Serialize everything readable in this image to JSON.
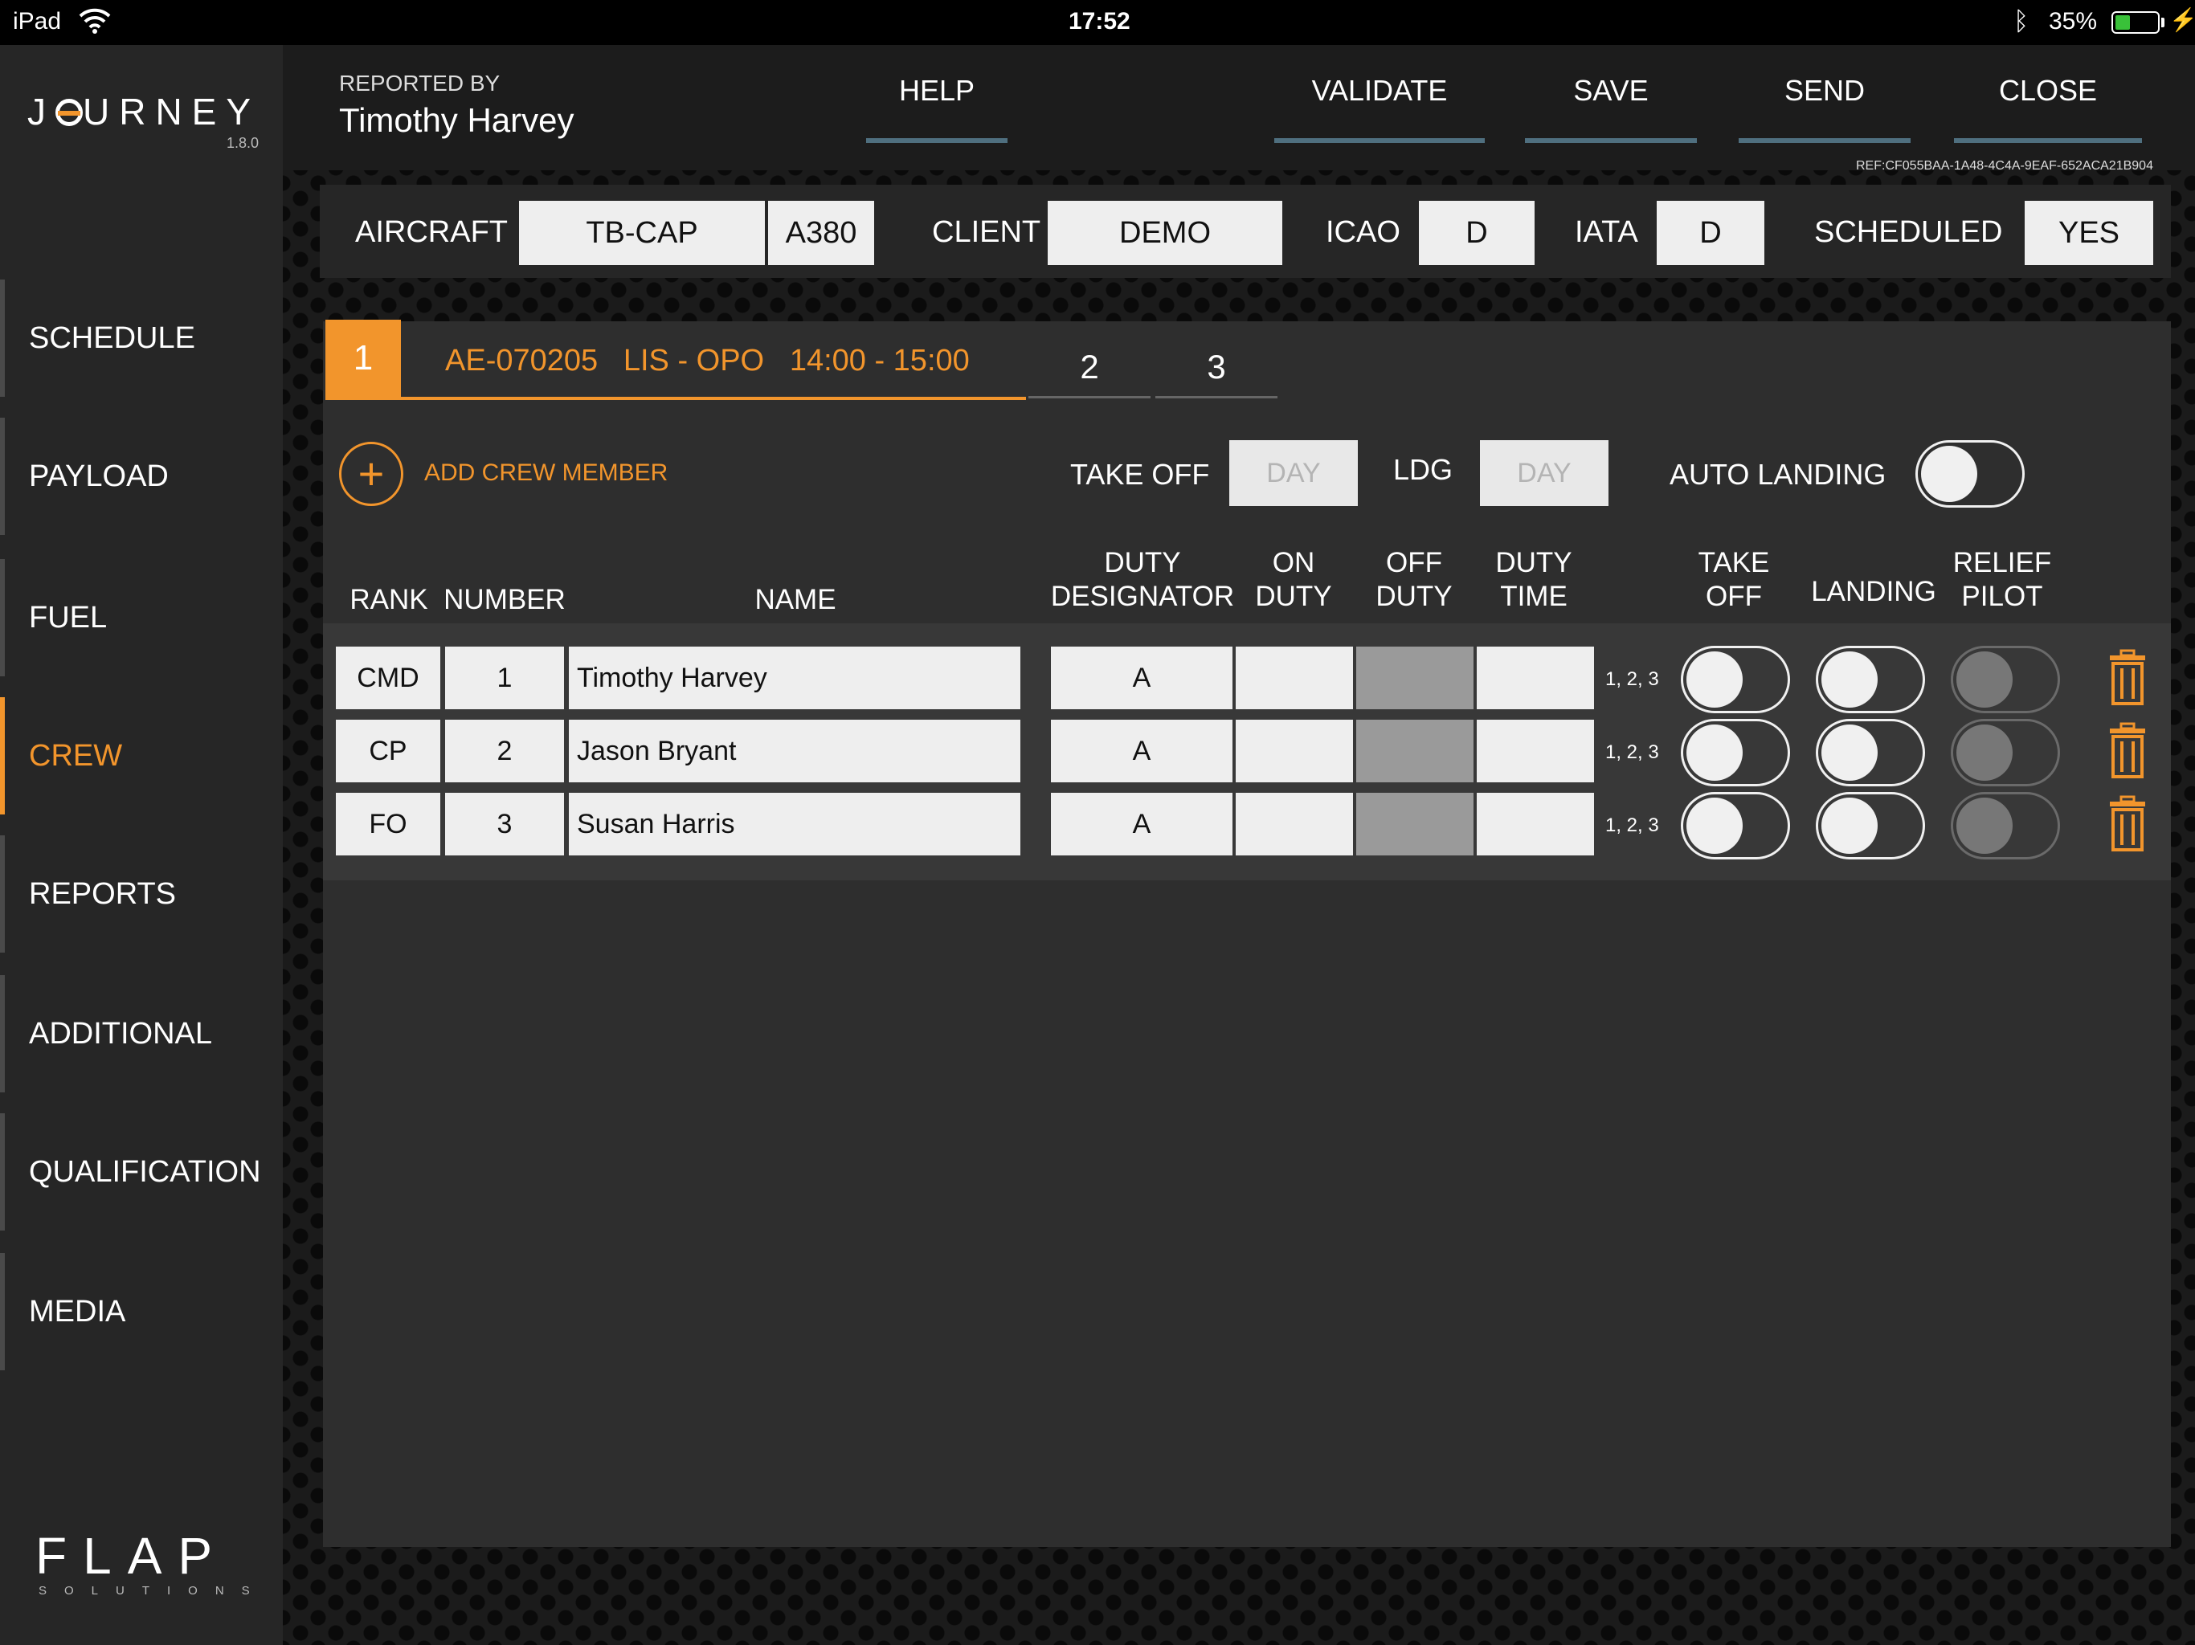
{
  "status_bar": {
    "device": "iPad",
    "time": "17:52",
    "battery": "35%",
    "battery_level": 0.35
  },
  "app": {
    "logo": "JOURNEY",
    "version": "1.8.0",
    "vendor_logo": "FLAP",
    "vendor_sub": "SOLUTIONS"
  },
  "sidebar": {
    "items": [
      {
        "label": "SCHEDULE",
        "active": false
      },
      {
        "label": "PAYLOAD",
        "active": false
      },
      {
        "label": "FUEL",
        "active": false
      },
      {
        "label": "CREW",
        "active": true
      },
      {
        "label": "REPORTS",
        "active": false
      },
      {
        "label": "ADDITIONAL",
        "active": false
      },
      {
        "label": "QUALIFICATION",
        "active": false
      },
      {
        "label": "MEDIA",
        "active": false
      }
    ]
  },
  "header": {
    "reported_by_label": "REPORTED BY",
    "reported_by_name": "Timothy Harvey",
    "buttons": {
      "help": "HELP",
      "validate": "VALIDATE",
      "save": "SAVE",
      "send": "SEND",
      "close": "CLOSE"
    },
    "ref": "REF:CF055BAA-1A48-4C4A-9EAF-652ACA21B904"
  },
  "aircraft_bar": {
    "aircraft_label": "AIRCRAFT",
    "aircraft_reg": "TB-CAP",
    "aircraft_type": "A380",
    "client_label": "CLIENT",
    "client": "DEMO",
    "icao_label": "ICAO",
    "icao": "D",
    "iata_label": "IATA",
    "iata": "D",
    "scheduled_label": "SCHEDULED",
    "scheduled": "YES"
  },
  "flight_tabs": {
    "active_number": "1",
    "active_flight": "AE-070205",
    "active_route": "LIS - OPO",
    "active_time": "14:00 - 15:00",
    "others": [
      "2",
      "3"
    ]
  },
  "crew_options": {
    "add_label": "ADD CREW MEMBER",
    "take_off_label": "TAKE OFF",
    "take_off_value": "DAY",
    "ldg_label": "LDG",
    "ldg_value": "DAY",
    "auto_landing_label": "AUTO LANDING",
    "auto_landing": false
  },
  "table": {
    "headers": {
      "rank": "RANK",
      "number": "NUMBER",
      "name": "NAME",
      "duty_designator_1": "DUTY",
      "duty_designator_2": "DESIGNATOR",
      "on_duty_1": "ON",
      "on_duty_2": "DUTY",
      "off_duty_1": "OFF",
      "off_duty_2": "DUTY",
      "duty_time_1": "DUTY",
      "duty_time_2": "TIME",
      "take_off_1": "TAKE",
      "take_off_2": "OFF",
      "landing": "LANDING",
      "relief_1": "RELIEF",
      "relief_2": "PILOT"
    },
    "rows": [
      {
        "rank": "CMD",
        "number": "1",
        "name": "Timothy Harvey",
        "designator": "A",
        "on_duty": "",
        "off_duty": "",
        "duty_time": "",
        "legs": "1, 2, 3"
      },
      {
        "rank": "CP",
        "number": "2",
        "name": "Jason Bryant",
        "designator": "A",
        "on_duty": "",
        "off_duty": "",
        "duty_time": "",
        "legs": "1, 2, 3"
      },
      {
        "rank": "FO",
        "number": "3",
        "name": "Susan Harris",
        "designator": "A",
        "on_duty": "",
        "off_duty": "",
        "duty_time": "",
        "legs": "1, 2, 3"
      }
    ]
  },
  "colors": {
    "accent": "#f2952c",
    "header_underline": "#4f6f7f",
    "battery": "#39c139"
  }
}
